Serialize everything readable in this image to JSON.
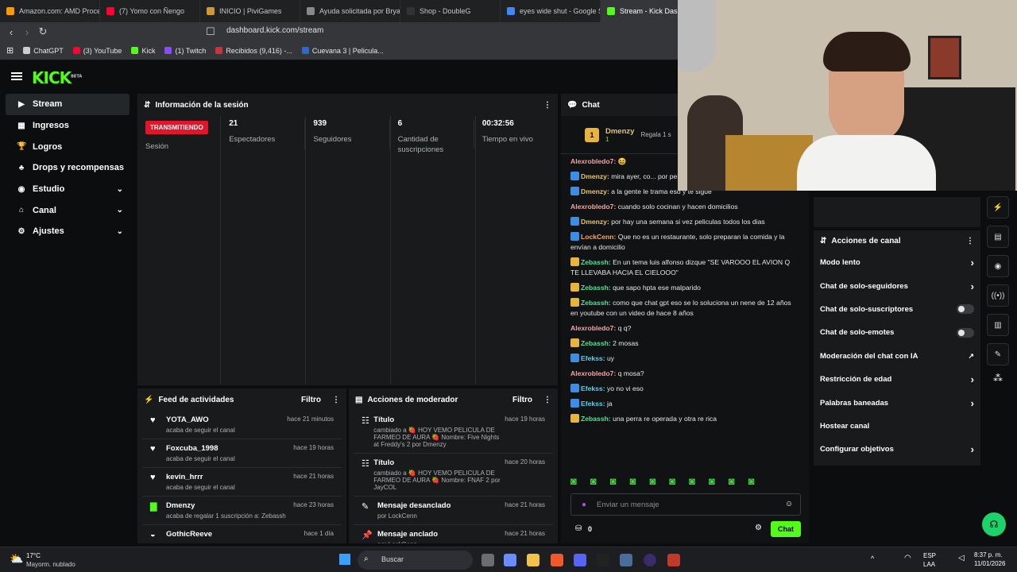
{
  "browser": {
    "tabs": [
      "Amazon.com: AMD Proces",
      "(7) Yomo con Ñengo",
      "INICIO | PiviGames",
      "Ayuda solicitada por Bryan",
      "Shop - DoubleG",
      "eyes wide shut - Google S",
      "Stream - Kick Dashb"
    ],
    "url": "dashboard.kick.com/stream",
    "bookmarks": [
      "ChatGPT",
      "(3) YouTube",
      "Kick",
      "(1) Twitch",
      "Recibidos (9,416) -...",
      "Cuevana 3 | Pelicula..."
    ]
  },
  "brand": {
    "logo": "KICK",
    "beta": "BETA"
  },
  "sidebar": {
    "items": [
      "Stream",
      "Ingresos",
      "Logros",
      "Drops y recompensas",
      "Estudio",
      "Canal",
      "Ajustes"
    ]
  },
  "session": {
    "title": "Información de la sesión",
    "status": "TRANSMITIENDO",
    "status_label": "Sesión",
    "stats": [
      {
        "value": "21",
        "label": "Espectadores"
      },
      {
        "value": "939",
        "label": "Seguidores"
      },
      {
        "value": "6",
        "label": "Cantidad de suscripciones"
      },
      {
        "value": "00:32:56",
        "label": "Tiempo en vivo"
      }
    ]
  },
  "feed": {
    "title": "Feed de actividades",
    "filter": "Filtro",
    "items": [
      {
        "name": "YOTA_AWO",
        "sub": "acaba de seguir el canal",
        "time": "hace 21 minutos"
      },
      {
        "name": "Foxcuba_1998",
        "sub": "acaba de seguir el canal",
        "time": "hace 19 horas"
      },
      {
        "name": "kevin_hrrr",
        "sub": "acaba de seguir el canal",
        "time": "hace 21 horas"
      },
      {
        "name": "Dmenzy",
        "sub": "acaba de regalar 1 suscripción a: Zebassh",
        "time": "hace 23 horas"
      },
      {
        "name": "GothicReeve",
        "sub": "",
        "time": "hace 1 día"
      }
    ]
  },
  "mod": {
    "title": "Acciones de moderador",
    "filter": "Filtro",
    "items": [
      {
        "name": "Título",
        "sub": "cambiado a 🍓 HOY VEMO PELICULA DE FARMEO DE AURA 🍓 Nombre: Five Nights at Freddy's 2 por Dmenzy",
        "time": "hace 19 horas"
      },
      {
        "name": "Título",
        "sub": "cambiado a 🍓 HOY VEMO PELICULA DE FARMEO DE AURA 🍓 Nombre: FNAF 2 por JayCOL",
        "time": "hace 20 horas"
      },
      {
        "name": "Mensaje desanclado",
        "sub": "por LockCenn",
        "time": "hace 21 horas"
      },
      {
        "name": "Mensaje anclado",
        "sub": "por LockCenn",
        "time": "hace 21 horas"
      }
    ]
  },
  "chat": {
    "title": "Chat",
    "top_user": "Dmenzy",
    "top_count": "1",
    "gift_label": "Regala 1 s",
    "messages": [
      {
        "user": "Alexrobledo7:",
        "color": "#f3a4a4",
        "text": "😆"
      },
      {
        "user": "Dmenzy:",
        "color": "#e8c46a",
        "text": "mira ayer, co... por pelicula"
      },
      {
        "user": "Dmenzy:",
        "color": "#e8c46a",
        "text": "a la gente le trama eso y te sigue"
      },
      {
        "user": "Alexrobledo7:",
        "color": "#f3a4a4",
        "text": "cuando solo cocinan y hacen domicilios"
      },
      {
        "user": "Dmenzy:",
        "color": "#e8c46a",
        "text": "por hay una semana si vez peliculas todos los dias"
      },
      {
        "user": "LockCenn:",
        "color": "#f3a86a",
        "text": "Que no es un restaurante, solo preparan la comida y la envían a domicilio"
      },
      {
        "user": "Zebassh:",
        "color": "#53e29a",
        "text": "En un tema luis alfonso dizque \"SE VAROOO EL AVION Q TE LLEVABA HACIA EL CIELOOO\""
      },
      {
        "user": "Zebassh:",
        "color": "#53e29a",
        "text": "que sapo hpta ese malparido"
      },
      {
        "user": "Zebassh:",
        "color": "#53e29a",
        "text": "como que chat gpt eso se lo soluciona un nene de 12 años en youtube con un video de hace 8 años"
      },
      {
        "user": "Alexrobledo7:",
        "color": "#f3a4a4",
        "text": "q q?"
      },
      {
        "user": "Zebassh:",
        "color": "#53e29a",
        "text": "2 mosas"
      },
      {
        "user": "Efekss:",
        "color": "#5ad1f0",
        "text": "uy"
      },
      {
        "user": "Alexrobledo7:",
        "color": "#f3a4a4",
        "text": "q mosa?"
      },
      {
        "user": "Efekss:",
        "color": "#5ad1f0",
        "text": "yo no vi eso"
      },
      {
        "user": "Efekss:",
        "color": "#5ad1f0",
        "text": "ja"
      },
      {
        "user": "Zebassh:",
        "color": "#53e29a",
        "text": "una perra re operada y otra re rica"
      }
    ],
    "placeholder": "Enviar un mensaje",
    "points": "0",
    "send": "Chat"
  },
  "actions": {
    "title": "Acciones de canal",
    "items": [
      "Modo lento",
      "Chat de solo-seguidores",
      "Chat de solo-suscriptores",
      "Chat de solo-emotes",
      "Moderación del chat con IA",
      "Restricción de edad",
      "Palabras baneadas",
      "Hostear canal",
      "Configurar objetivos"
    ]
  },
  "taskbar": {
    "temp": "17°C",
    "weather": "Mayorm. nublado",
    "search": "Buscar",
    "lang": "ESP",
    "region": "LAA",
    "time": "8:37 p. m.",
    "date": "11/01/2026"
  }
}
